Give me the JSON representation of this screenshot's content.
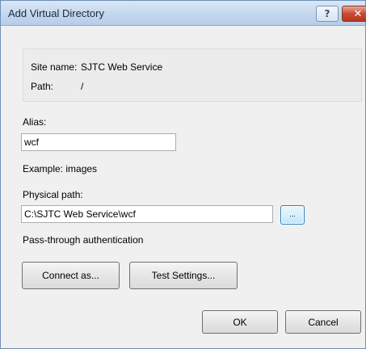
{
  "window": {
    "title": "Add Virtual Directory",
    "help_glyph": "?",
    "close_glyph": "✕"
  },
  "site_info": {
    "site_name_label": "Site name:",
    "site_name_value": "SJTC Web Service",
    "path_label": "Path:",
    "path_value": "/"
  },
  "alias": {
    "label": "Alias:",
    "value": "wcf",
    "example": "Example: images"
  },
  "physical_path": {
    "label": "Physical path:",
    "value": "C:\\SJTC Web Service\\wcf",
    "browse_label": "..."
  },
  "auth": {
    "label": "Pass-through authentication"
  },
  "buttons": {
    "connect_as": "Connect as...",
    "test_settings": "Test Settings...",
    "ok": "OK",
    "cancel": "Cancel"
  }
}
